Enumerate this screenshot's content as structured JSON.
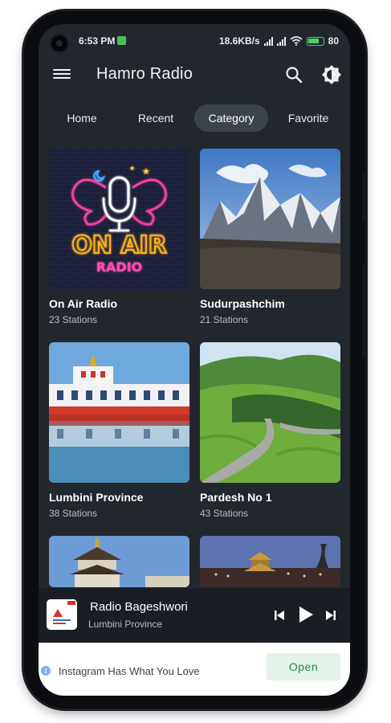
{
  "status_bar": {
    "time": "6:53 PM",
    "network_speed": "18.6KB/s",
    "battery_level": "80"
  },
  "app_bar": {
    "title": "Hamro Radio",
    "icons": [
      "menu-icon",
      "search-icon",
      "brightness-icon"
    ]
  },
  "tabs": [
    {
      "label": "Home",
      "active": false
    },
    {
      "label": "Recent",
      "active": false
    },
    {
      "label": "Category",
      "active": true
    },
    {
      "label": "Favorite",
      "active": false
    }
  ],
  "categories": [
    {
      "name": "On Air Radio",
      "count": "23 Stations"
    },
    {
      "name": "Sudurpashchim",
      "count": "21 Stations"
    },
    {
      "name": "Lumbini Province",
      "count": "38 Stations"
    },
    {
      "name": "Pardesh No 1",
      "count": "43 Stations"
    }
  ],
  "thumbnail_art": {
    "neon_sign_top": "ON AIR",
    "neon_sign_bottom": "RADIO"
  },
  "now_playing": {
    "station": "Radio Bageshwori",
    "region": "Lumbini Province",
    "controls": [
      "previous-icon",
      "play-icon",
      "next-icon"
    ]
  },
  "ad_banner": {
    "text": "Instagram Has What You Love",
    "button": "Open"
  },
  "colors": {
    "screen_bg": "#22272e",
    "active_tab_bg": "#3d434c",
    "player_bg": "#1a1e24",
    "ad_button_text": "#1e8e3e"
  }
}
